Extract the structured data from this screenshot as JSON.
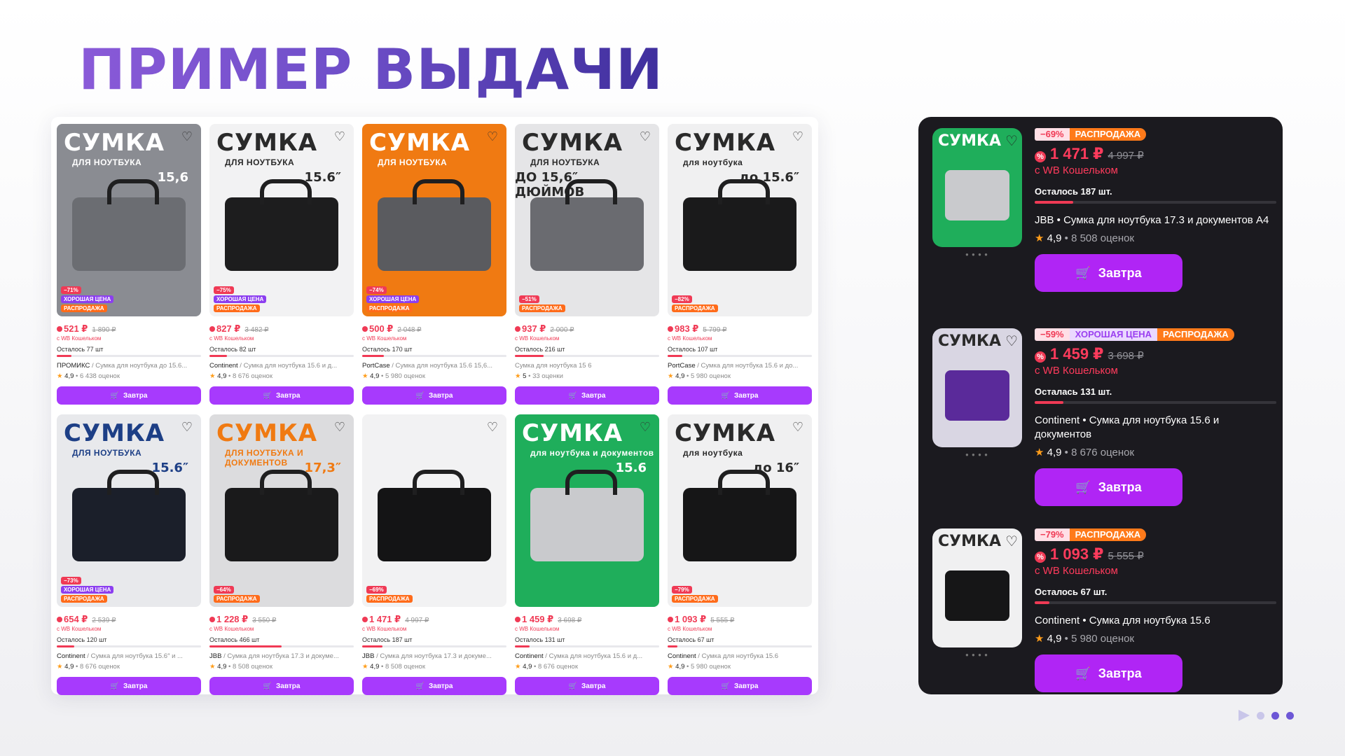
{
  "slide": {
    "title": "ПРИМЕР ВЫДАЧИ"
  },
  "colors": {
    "accent": "#a73afd",
    "price": "#f03a55",
    "sale": "#ff6b1a",
    "dark_panel": "#1b1a1f"
  },
  "grid": {
    "buy_label": "Завтра",
    "wallet_label": "с WB Кошельком",
    "cards": [
      {
        "thumb_head": "СУМКА",
        "thumb_sub": "ДЛЯ НОУТБУКА",
        "thumb_size": "15,6",
        "thumb_bg": "#8a8c92",
        "thumb_fg": "#ffffff",
        "bag_color": "#6b6d72",
        "discount": "−71%",
        "good_price": "ХОРОШАЯ ЦЕНА",
        "sale": "РАСПРОДАЖА",
        "price": "521 ₽",
        "old_price": "1 890 ₽",
        "left": "Осталось 77 шт",
        "stock": 0.1,
        "brand": "ПРОМИКС",
        "title": " / Сумка для ноутбука до 15.6...",
        "rating": "4,9",
        "reviews": "6 438 оценок"
      },
      {
        "thumb_head": "СУМКА",
        "thumb_sub": "ДЛЯ НОУТБУКА",
        "thumb_size": "15.6″",
        "thumb_bg": "#f2f2f3",
        "thumb_fg": "#2a2a2a",
        "bag_color": "#1d1d1e",
        "discount": "−75%",
        "good_price": "ХОРОШАЯ ЦЕНА",
        "sale": "РАСПРОДАЖА",
        "price": "827 ₽",
        "old_price": "3 482 ₽",
        "left": "Осталось 82 шт",
        "stock": 0.12,
        "brand": "Continent",
        "title": " / Сумка для ноутбука 15.6 и д...",
        "rating": "4,9",
        "reviews": "8 676 оценок"
      },
      {
        "thumb_head": "СУМКА",
        "thumb_sub": "ДЛЯ НОУТБУКА",
        "thumb_size": "",
        "thumb_bg": "#f07a12",
        "thumb_fg": "#ffffff",
        "bag_color": "#5a5b5f",
        "discount": "−74%",
        "good_price": "ХОРОШАЯ ЦЕНА",
        "sale": "РАСПРОДАЖА",
        "price": "500 ₽",
        "old_price": "2 048 ₽",
        "left": "Осталось 170 шт",
        "stock": 0.15,
        "brand": "PortCase",
        "title": " / Сумка для ноутбука 15.6 15,6...",
        "rating": "4,9",
        "reviews": "5 980 оценок"
      },
      {
        "thumb_head": "СУМКА",
        "thumb_sub": "ДЛЯ НОУТБУКА",
        "thumb_size": "ДО 15,6″ ДЮЙМОВ",
        "thumb_bg": "#e5e5e7",
        "thumb_fg": "#2a2a2a",
        "bag_color": "#6a6b70",
        "discount": "−51%",
        "good_price": "",
        "sale": "РАСПРОДАЖА",
        "price": "937 ₽",
        "old_price": "2 000 ₽",
        "left": "Осталось 216 шт",
        "stock": 0.2,
        "brand": "",
        "title": "Сумка для ноутбука 15 6",
        "rating": "5",
        "reviews": "33 оценки"
      },
      {
        "thumb_head": "СУМКА",
        "thumb_sub": "для ноутбука",
        "thumb_size": "до 15.6″",
        "thumb_bg": "#f0f0f1",
        "thumb_fg": "#2a2a2a",
        "bag_color": "#1a1a1b",
        "discount": "−82%",
        "good_price": "",
        "sale": "РАСПРОДАЖА",
        "price": "983 ₽",
        "old_price": "5 799 ₽",
        "left": "Осталось 107 шт",
        "stock": 0.1,
        "brand": "PortCase",
        "title": " / Сумка для ноутбука 15.6 и до...",
        "rating": "4,9",
        "reviews": "5 980 оценок"
      },
      {
        "thumb_head": "СУМКА",
        "thumb_sub": "ДЛЯ НОУТБУКА",
        "thumb_size": "15.6″",
        "thumb_bg": "#e8e9ec",
        "thumb_fg": "#1d3f86",
        "bag_color": "#1b1f2a",
        "discount": "−73%",
        "good_price": "ХОРОШАЯ ЦЕНА",
        "sale": "РАСПРОДАЖА",
        "price": "654 ₽",
        "old_price": "2 539 ₽",
        "left": "Осталось 120 шт",
        "stock": 0.12,
        "brand": "Continent",
        "title": " / Сумка для ноутбука 15.6″ и ...",
        "rating": "4,9",
        "reviews": "8 676 оценок"
      },
      {
        "thumb_head": "СУМКА",
        "thumb_sub": "ДЛЯ НОУТБУКА И ДОКУМЕНТОВ",
        "thumb_size": "17,3″",
        "thumb_bg": "#dcdcde",
        "thumb_fg": "#f07a12",
        "bag_color": "#1a1a1b",
        "discount": "−64%",
        "good_price": "",
        "sale": "РАСПРОДАЖА",
        "price": "1 228 ₽",
        "old_price": "3 550 ₽",
        "left": "Осталось 466 шт",
        "stock": 0.5,
        "brand": "JBB",
        "title": " / Сумка для ноутбука 17.3 и докуме...",
        "rating": "4,9",
        "reviews": "8 508 оценок"
      },
      {
        "thumb_head": "",
        "thumb_sub": "",
        "thumb_size": "",
        "thumb_bg": "#f2f2f3",
        "thumb_fg": "#2a2a2a",
        "bag_color": "#141415",
        "discount": "−69%",
        "good_price": "",
        "sale": "РАСПРОДАЖА",
        "price": "1 471 ₽",
        "old_price": "4 997 ₽",
        "left": "Осталось 187 шт",
        "stock": 0.14,
        "brand": "JBB",
        "title": " / Сумка для ноутбука 17.3 и докуме...",
        "rating": "4,9",
        "reviews": "8 508 оценок"
      },
      {
        "thumb_head": "СУМКА",
        "thumb_sub": "для ноутбука и документов",
        "thumb_size": "15.6",
        "thumb_bg": "#1fae5b",
        "thumb_fg": "#ffffff",
        "bag_color": "#c9cacd",
        "discount": "",
        "good_price": "",
        "sale": "",
        "price": "1 459 ₽",
        "old_price": "3 698 ₽",
        "left": "Осталось 131 шт",
        "stock": 0.1,
        "brand": "Continent",
        "title": " / Сумка для ноутбука 15.6 и д...",
        "rating": "4,9",
        "reviews": "8 676 оценок"
      },
      {
        "thumb_head": "СУМКА",
        "thumb_sub": "для ноутбука",
        "thumb_size": "до 16″",
        "thumb_bg": "#f0f0f1",
        "thumb_fg": "#2a2a2a",
        "bag_color": "#161617",
        "discount": "−79%",
        "good_price": "",
        "sale": "РАСПРОДАЖА",
        "price": "1 093 ₽",
        "old_price": "5 555 ₽",
        "left": "Осталось 67 шт",
        "stock": 0.07,
        "brand": "Continent",
        "title": " / Сумка для ноутбука 15.6",
        "rating": "4,9",
        "reviews": "5 980 оценок"
      }
    ]
  },
  "list": {
    "buy_label": "Завтра",
    "wallet_label": "с WB Кошельком",
    "items": [
      {
        "thumb_head": "СУМКА",
        "thumb_bg": "#1fae5b",
        "thumb_fg": "#ffffff",
        "bag_color": "#c9cacd",
        "discount": "−69%",
        "good_price": "",
        "sale": "РАСПРОДАЖА",
        "price": "1 471 ₽",
        "old_price": "4 997 ₽",
        "left": "Осталось 187 шт.",
        "stock": 0.16,
        "title": "JBB • Сумка для ноутбука 17.3 и документов А4",
        "rating": "4,9",
        "reviews": "8 508 оценок"
      },
      {
        "thumb_head": "СУМКА",
        "thumb_bg": "#d9d6e3",
        "thumb_fg": "#2a2a2a",
        "bag_color": "#5a2a9a",
        "discount": "−59%",
        "good_price": "ХОРОШАЯ ЦЕНА",
        "sale": "РАСПРОДАЖА",
        "price": "1 459 ₽",
        "old_price": "3 698 ₽",
        "left": "Осталась 131 шт.",
        "stock": 0.12,
        "title": "Continent • Сумка для ноутбука 15.6 и документов",
        "rating": "4,9",
        "reviews": "8 676 оценок"
      },
      {
        "thumb_head": "СУМКА",
        "thumb_bg": "#f0f0f1",
        "thumb_fg": "#2a2a2a",
        "bag_color": "#161617",
        "discount": "−79%",
        "good_price": "",
        "sale": "РАСПРОДАЖА",
        "price": "1 093 ₽",
        "old_price": "5 555 ₽",
        "left": "Осталось 67 шт.",
        "stock": 0.06,
        "title": "Continent • Сумка для ноутбука 15.6",
        "rating": "4,9",
        "reviews": "5 980 оценок"
      }
    ]
  }
}
